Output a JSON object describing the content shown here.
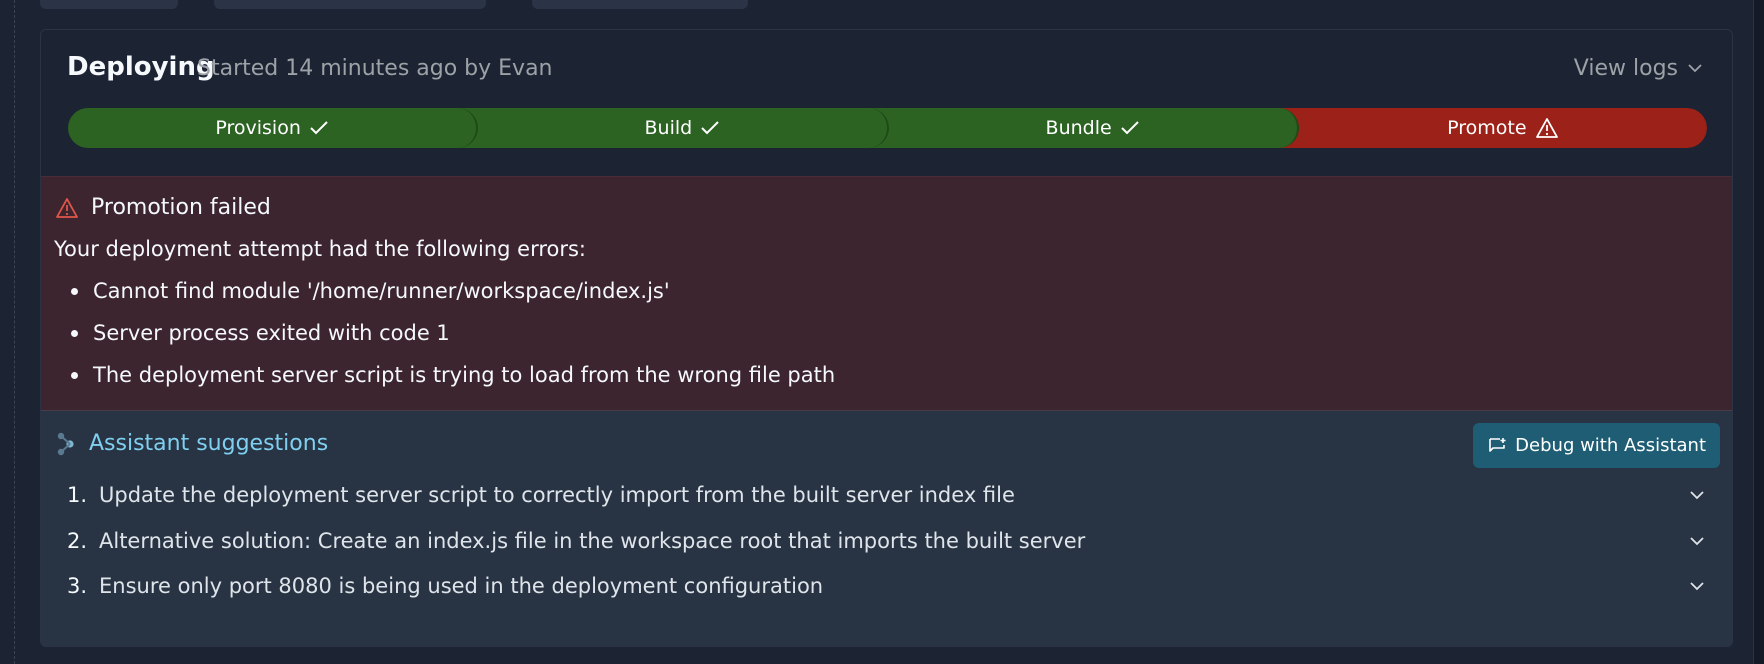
{
  "header": {
    "title": "Deploying",
    "subtitle": "Started 14 minutes ago by Evan",
    "view_logs_label": "View logs"
  },
  "stages": [
    {
      "label": "Provision",
      "status": "success",
      "icon": "check-icon"
    },
    {
      "label": "Build",
      "status": "success",
      "icon": "check-icon"
    },
    {
      "label": "Bundle",
      "status": "success",
      "icon": "check-icon"
    },
    {
      "label": "Promote",
      "status": "failed",
      "icon": "warning-icon"
    }
  ],
  "error": {
    "title": "Promotion failed",
    "intro": "Your deployment attempt had the following errors:",
    "items": [
      "Cannot find module '/home/runner/workspace/index.js'",
      "Server process exited with code 1",
      "The deployment server script is trying to load from the wrong file path"
    ]
  },
  "assistant": {
    "title": "Assistant suggestions",
    "debug_button_label": "Debug with Assistant",
    "suggestions": [
      {
        "number": "1.",
        "text": "Update the deployment server script to correctly import from the built server index file"
      },
      {
        "number": "2.",
        "text": "Alternative solution: Create an index.js file in the workspace root that imports the built server"
      },
      {
        "number": "3.",
        "text": "Ensure only port 8080 is being used in the deployment configuration"
      }
    ]
  },
  "colors": {
    "background": "#1c2333",
    "stage_success": "#2c6323",
    "stage_failed": "#9c2219",
    "error_bg": "#3d2530",
    "assistant_bg": "#283444",
    "assistant_accent": "#7fd0f0",
    "debug_button": "#1e5d74"
  }
}
